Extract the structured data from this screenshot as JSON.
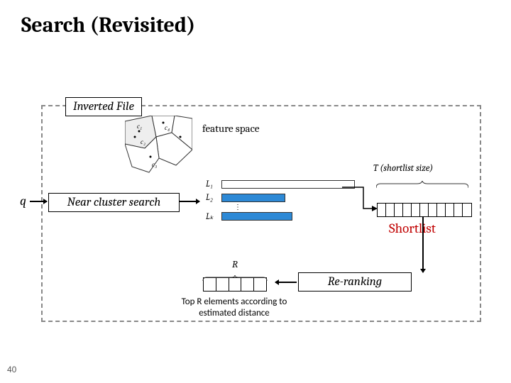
{
  "slide": {
    "title": "Search (Revisited)",
    "page_number": "40"
  },
  "labels": {
    "inverted_file": "Inverted File",
    "feature_space": "feature space",
    "near_cluster": "Near cluster search",
    "shortlist": "Shortlist",
    "re_ranking": "Re-ranking"
  },
  "vars": {
    "q": "q",
    "T": "T (shortlist size)",
    "R": "R",
    "L1": "L₁",
    "L2": "L₂",
    "Lk": "Lₖ"
  },
  "caption": {
    "top_r": "Top R elements according to estimated distance"
  },
  "centroids": {
    "c1": "c₁",
    "c2": "c₂",
    "c3": "c₃",
    "c4": "c₄"
  }
}
